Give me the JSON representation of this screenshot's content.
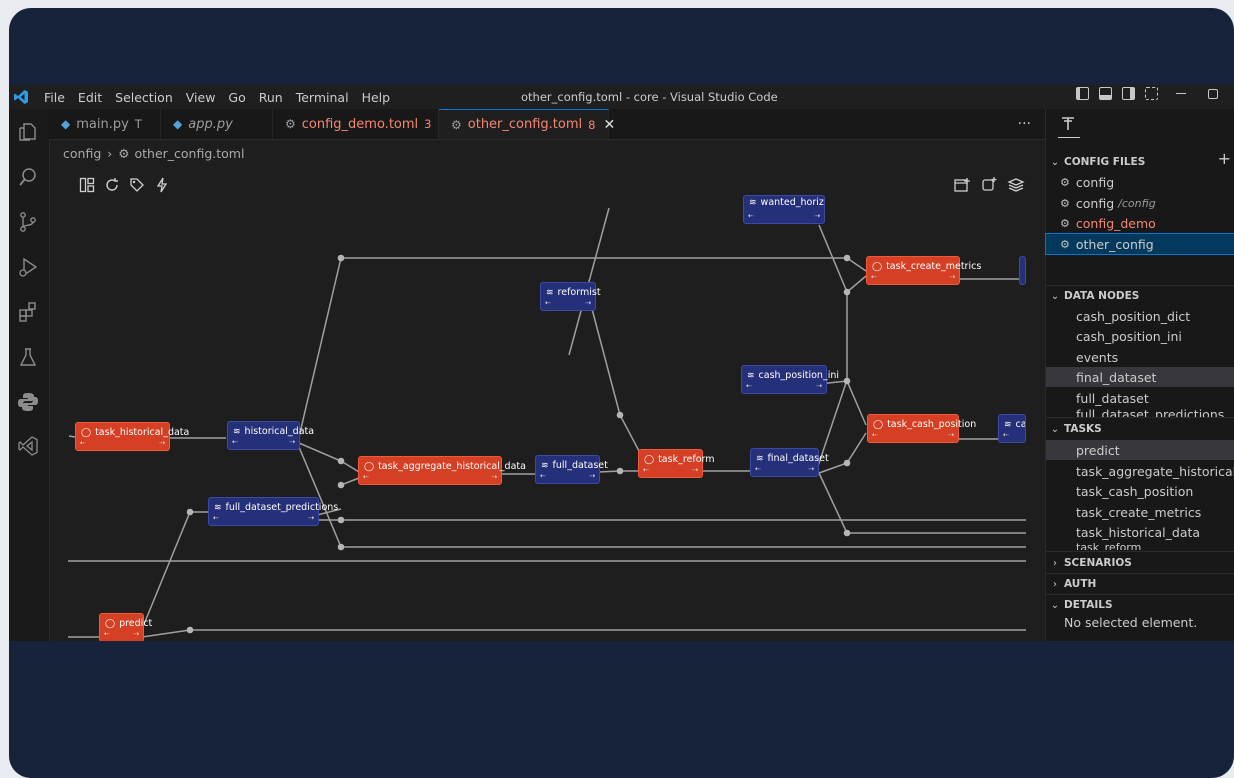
{
  "titlebar": {
    "menu": [
      "File",
      "Edit",
      "Selection",
      "View",
      "Go",
      "Run",
      "Terminal",
      "Help"
    ],
    "window_title": "other_config.toml - core - Visual Studio Code"
  },
  "tabs": [
    {
      "label": "main.py",
      "badge": "T",
      "kind": "python"
    },
    {
      "label": "app.py",
      "badge": "",
      "kind": "python"
    },
    {
      "label": "config_demo.toml",
      "badge": "3",
      "kind": "toml"
    },
    {
      "label": "other_config.toml",
      "badge": "8",
      "kind": "toml"
    }
  ],
  "tabs_more": "···",
  "breadcrumb": {
    "folder": "config",
    "file": "other_config.toml"
  },
  "nodes": {
    "task_historical_data": "task_historical_data",
    "historical_data": "historical_data",
    "full_dataset_predictions": "full_dataset_predictions",
    "task_aggregate_historical_data": "task_aggregate_historical_data",
    "full_dataset": "full_dataset",
    "reformist": "reformist",
    "task_reform": "task_reform",
    "final_dataset": "final_dataset",
    "cash_position_ini": "cash_position_ini",
    "task_cash_position": "task_cash_position",
    "cas": "cas",
    "wanted_horizon": "wanted_horizon ?",
    "task_create_metrics": "task_create_metrics",
    "predict": "predict",
    "in_port": "⇠",
    "out_port": "⇢"
  },
  "sidebar": {
    "config_files_title": "CONFIG FILES",
    "config_files": [
      {
        "label": "config",
        "sub": ""
      },
      {
        "label": "config",
        "sub": "/config"
      },
      {
        "label": "config_demo",
        "sub": ""
      },
      {
        "label": "other_config",
        "sub": ""
      }
    ],
    "data_nodes_title": "DATA NODES",
    "data_nodes": [
      "cash_position_dict",
      "cash_position_ini",
      "events",
      "final_dataset",
      "full_dataset",
      "full_dataset_predictions"
    ],
    "tasks_title": "TASKS",
    "tasks": [
      "predict",
      "task_aggregate_historical_data",
      "task_cash_position",
      "task_create_metrics",
      "task_historical_data",
      "task_reform"
    ],
    "scenarios_title": "SCENARIOS",
    "auth_title": "AUTH",
    "details_title": "DETAILS",
    "details_msg": "No selected element."
  },
  "colors": {
    "task": "#d53f24",
    "data": "#25307a",
    "accent": "#0078d4",
    "modified": "#f48771"
  }
}
